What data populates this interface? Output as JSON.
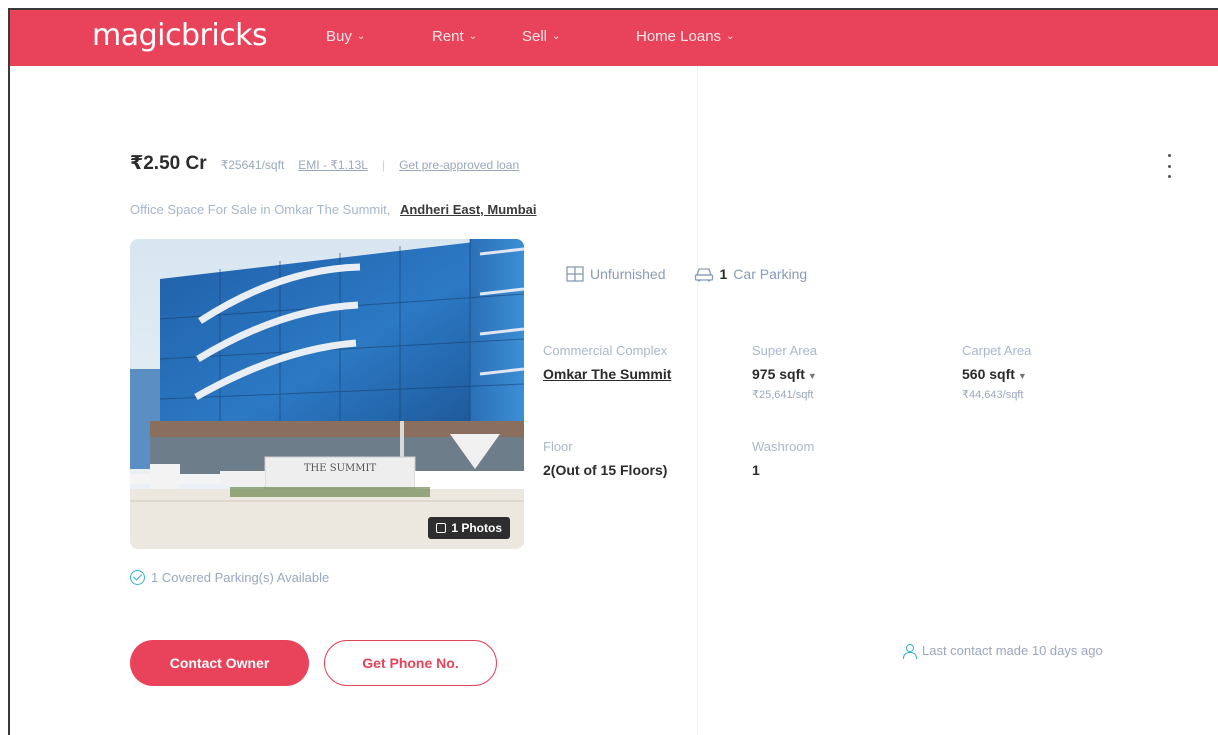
{
  "header": {
    "logo": "magicbricks",
    "nav": [
      {
        "label": "Buy"
      },
      {
        "label": "Rent"
      },
      {
        "label": "Sell"
      },
      {
        "label": "Home Loans"
      }
    ]
  },
  "listing": {
    "price": "₹2.50 Cr",
    "price_per_sqft": "₹25641/sqft",
    "emi": "EMI - ₹1.13L",
    "separator": "|",
    "loan_link": "Get pre-approved loan",
    "title": "Office Space For Sale in Omkar The Summit,",
    "location": "Andheri East, Mumbai",
    "photo_badge": "1 Photos",
    "photo_sign": "THE SUMMIT",
    "features": [
      {
        "icon": "furnishing-icon",
        "label": "Unfurnished"
      },
      {
        "icon": "car-icon",
        "count": "1",
        "label": "Car Parking"
      }
    ],
    "summary": {
      "complex_label": "Commercial Complex",
      "complex_value": "Omkar The Summit",
      "super_area_label": "Super Area",
      "super_area_value": "975 sqft",
      "super_area_sub": "₹25,641/sqft",
      "carpet_area_label": "Carpet Area",
      "carpet_area_value": "560 sqft",
      "carpet_area_sub": "₹44,643/sqft",
      "floor_label": "Floor",
      "floor_value": "2(Out of 15 Floors)",
      "washroom_label": "Washroom",
      "washroom_value": "1"
    },
    "parking_available": "1 Covered Parking(s) Available",
    "contact_button": "Contact Owner",
    "phone_button": "Get Phone No.",
    "last_contact": "Last contact made 10 days ago"
  },
  "colors": {
    "brand": "#e8435a",
    "accent_teal": "#3ab1c9",
    "muted_text": "#9aa8bd"
  }
}
